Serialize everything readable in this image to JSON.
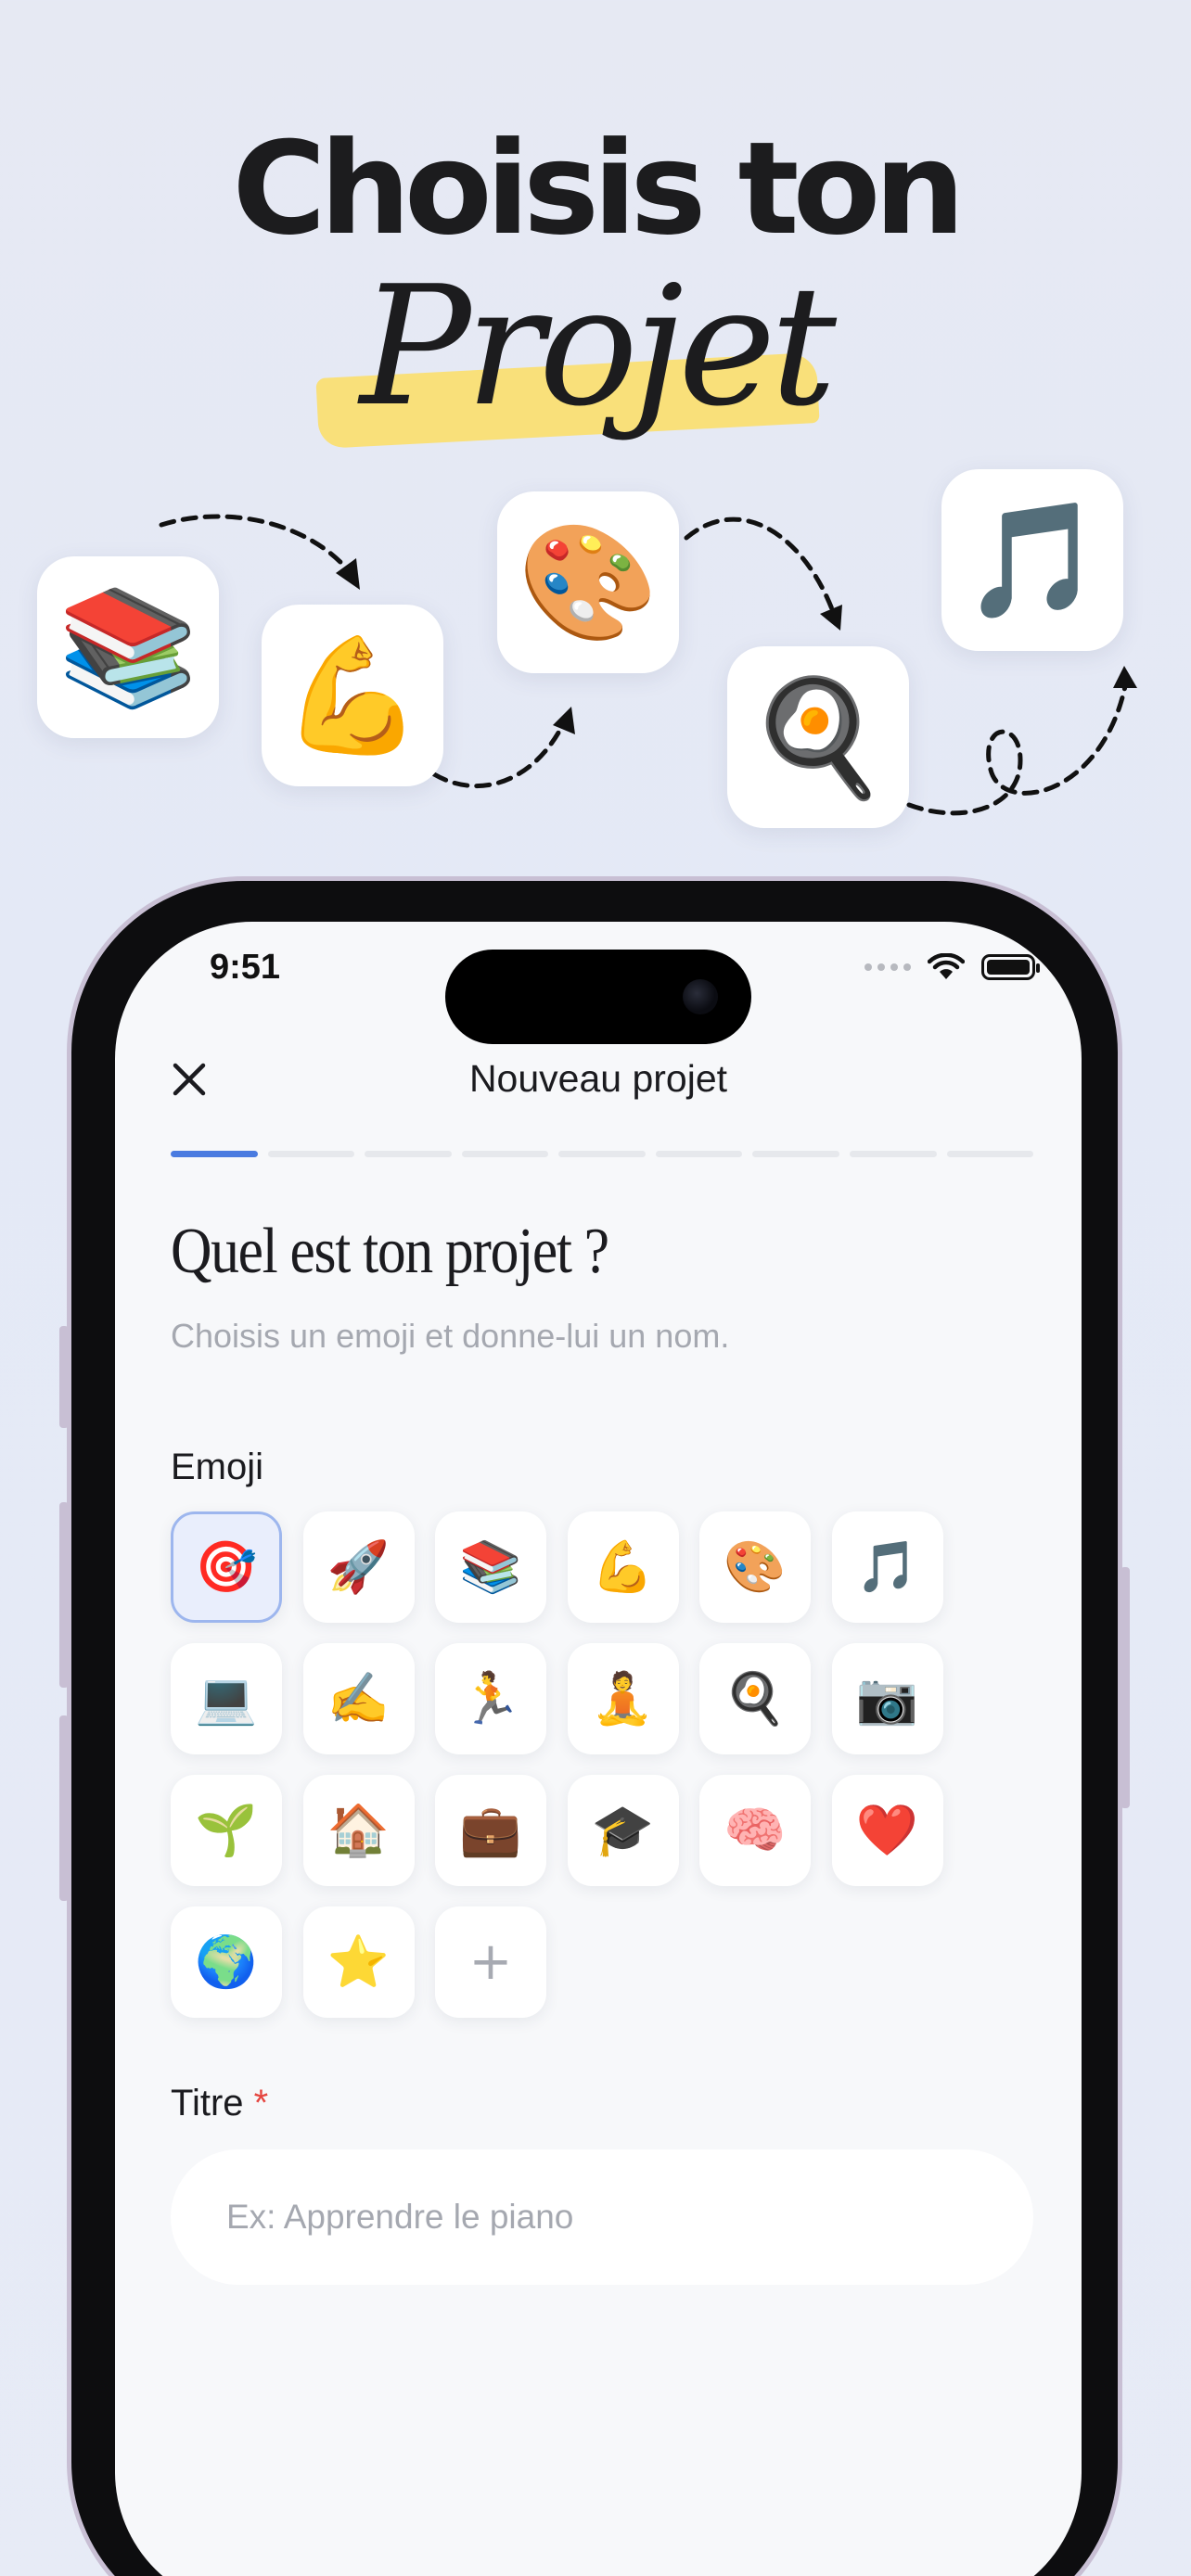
{
  "promo": {
    "headline_line1": "Choisis ton",
    "headline_line2": "Projet",
    "emojis": [
      "📚",
      "💪",
      "🎨",
      "🍳",
      "🎵"
    ]
  },
  "status_bar": {
    "time": "9:51"
  },
  "nav": {
    "title": "Nouveau projet",
    "close_icon": "✕"
  },
  "progress": {
    "current_step": 1,
    "total_steps": 9
  },
  "form": {
    "question": "Quel est ton projet ?",
    "subtitle": "Choisis un emoji et donne-lui un nom.",
    "emoji_label": "Emoji",
    "emojis": [
      "🎯",
      "🚀",
      "📚",
      "💪",
      "🎨",
      "🎵",
      "💻",
      "✍️",
      "🏃",
      "🧘",
      "🍳",
      "📷",
      "🌱",
      "🏠",
      "💼",
      "🎓",
      "🧠",
      "❤️",
      "🌍",
      "⭐"
    ],
    "selected_emoji": "🎯",
    "add_emoji_label": "+",
    "title_label": "Titre",
    "title_required_marker": "*",
    "title_placeholder": "Ex: Apprendre le piano"
  },
  "colors": {
    "accent": "#4a7be0",
    "selected_border": "#9db6ee",
    "highlight": "#f9e07a",
    "required": "#e5453f"
  }
}
